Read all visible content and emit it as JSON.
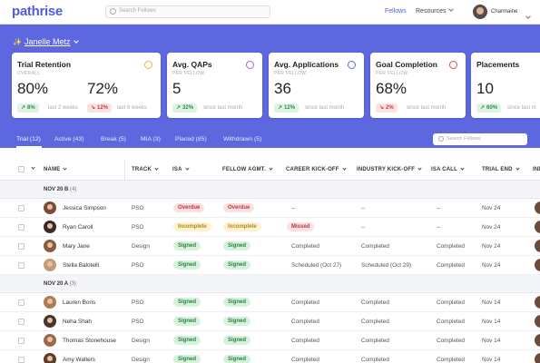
{
  "app": {
    "logo": "pathrise",
    "search_placeholder": "Search Fellows",
    "nav": {
      "fellows": "Fellows",
      "resources": "Resources"
    },
    "user": "Charmaine"
  },
  "header": {
    "coach_name": "Janelle Metz"
  },
  "cards": [
    {
      "title": "Trial Retention",
      "sub": "OVERALL",
      "value": "80%",
      "value2": "72%",
      "pill": "8%",
      "pill_dir": "up",
      "caption": "last 2 weeks",
      "pill2": "12%",
      "pill2_dir": "down",
      "caption2": "last 6 weeks",
      "icon": "clock-icon",
      "icon_color": "#f2b33d"
    },
    {
      "title": "Avg. QAPs",
      "sub": "PER FELLOW",
      "value": "5",
      "pill": "32%",
      "pill_dir": "up",
      "caption": "since last month",
      "icon": "user-search-icon",
      "icon_color": "#b05fd6"
    },
    {
      "title": "Avg. Applications",
      "sub": "PER FELLOW",
      "value": "36",
      "pill": "12%",
      "pill_dir": "up",
      "caption": "since last month",
      "icon": "clipboard-icon",
      "icon_color": "#5c67e0"
    },
    {
      "title": "Goal Completion",
      "sub": "PER FELLOW",
      "value": "68%",
      "pill": "2%",
      "pill_dir": "down",
      "caption": "since last month",
      "icon": "check-circle-icon",
      "icon_color": "#e04b4b"
    },
    {
      "title": "Placements",
      "sub": "",
      "value": "10",
      "pill": "60%",
      "pill_dir": "up",
      "caption": "since last m"
    }
  ],
  "tabs": [
    {
      "label": "Trial (12)",
      "active": true
    },
    {
      "label": "Active (43)"
    },
    {
      "label": "Break (5)"
    },
    {
      "label": "MIA (3)"
    },
    {
      "label": "Placed (85)"
    },
    {
      "label": "Withdrawn (5)"
    }
  ],
  "table_search_placeholder": "Search Fellows",
  "columns": [
    "NAME",
    "TRACK",
    "ISA",
    "FELLOW AGMT.",
    "CAREER KICK-OFF",
    "INDUSTRY KICK-OFF",
    "ISA CALL",
    "TRIAL END",
    "IND"
  ],
  "groups": [
    {
      "label": "NOV 20 B",
      "count": "(4)",
      "rows": [
        {
          "name": "Jessica Simpson",
          "track": "PSO",
          "isa": "Overdue",
          "agmt": "Overdue",
          "career": "--",
          "industry": "--",
          "isa_call": "--",
          "trial_end": "Nov 24"
        },
        {
          "name": "Ryan Caroll",
          "track": "PSO",
          "isa": "Incomplete",
          "agmt": "Incomplete",
          "career": "Missed",
          "industry": "--",
          "isa_call": "--",
          "trial_end": "Nov 24"
        },
        {
          "name": "Mary Jane",
          "track": "Design",
          "isa": "Signed",
          "agmt": "Signed",
          "career": "Completed",
          "industry": "Completed",
          "isa_call": "Completed",
          "trial_end": "Nov 24"
        },
        {
          "name": "Stella Balotelli",
          "track": "PSO",
          "isa": "Signed",
          "agmt": "Signed",
          "career": "Scheduled (Oct 27)",
          "industry": "Scheduled (Oct 29)",
          "isa_call": "Completed",
          "trial_end": "Nov 24"
        }
      ]
    },
    {
      "label": "NOV 20 A",
      "count": "(3)",
      "rows": [
        {
          "name": "Lauren Boris",
          "track": "PSO",
          "isa": "Signed",
          "agmt": "Signed",
          "career": "Completed",
          "industry": "Completed",
          "isa_call": "Completed",
          "trial_end": "Nov 14"
        },
        {
          "name": "Neha Shah",
          "track": "PSO",
          "isa": "Signed",
          "agmt": "Signed",
          "career": "Completed",
          "industry": "Completed",
          "isa_call": "Completed",
          "trial_end": "Nov 14"
        },
        {
          "name": "Thomas Stonehouse",
          "track": "Design",
          "isa": "Signed",
          "agmt": "Signed",
          "career": "Completed",
          "industry": "Completed",
          "isa_call": "Completed",
          "trial_end": "Nov 14"
        },
        {
          "name": "Amy Walters",
          "track": "Design",
          "isa": "Signed",
          "agmt": "Signed",
          "career": "Completed",
          "industry": "Completed",
          "isa_call": "Completed",
          "trial_end": "Nov 14"
        }
      ]
    }
  ]
}
